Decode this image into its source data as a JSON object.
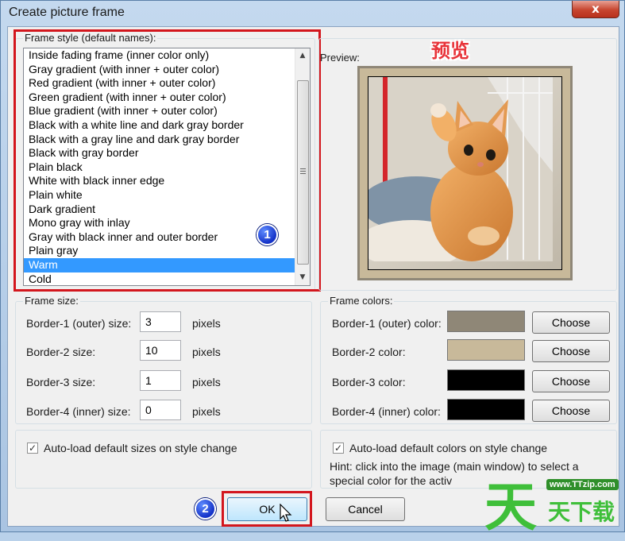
{
  "window": {
    "title": "Create picture frame",
    "close_glyph": "x"
  },
  "frame_style": {
    "group_label": "Frame style (default names):",
    "items": [
      "Inside fading frame (inner color only)",
      "Gray gradient (with inner + outer color)",
      "Red gradient (with inner + outer color)",
      "Green gradient (with inner + outer color)",
      "Blue gradient (with inner + outer color)",
      "Black with a white line and dark gray border",
      "Black with a gray line and dark gray border",
      "Black with gray border",
      "Plain black",
      "White with black inner edge",
      "Plain white",
      "Dark gradient",
      "Mono gray with inlay",
      "Gray with black inner and outer border",
      "Plain gray",
      "Warm",
      "Cold"
    ],
    "selected_index": 15,
    "scroll_up": "▲",
    "scroll_down": "▼"
  },
  "annotation": {
    "preview_cn": "预览",
    "badge_1": "1",
    "badge_2": "2",
    "highlight_color": "#d3161d",
    "badge_color": "#1432c8"
  },
  "preview": {
    "label": "Preview:"
  },
  "frame_size": {
    "group_label": "Frame size:",
    "unit": "pixels",
    "rows": [
      {
        "label": "Border-1 (outer) size:",
        "value": "3"
      },
      {
        "label": "Border-2 size:",
        "value": "10"
      },
      {
        "label": "Border-3 size:",
        "value": "1"
      },
      {
        "label": "Border-4 (inner) size:",
        "value": "0"
      }
    ],
    "autoload_label": "Auto-load default sizes on style change",
    "autoload_checked": true
  },
  "frame_colors": {
    "group_label": "Frame colors:",
    "choose_label": "Choose",
    "rows": [
      {
        "label": "Border-1 (outer) color:",
        "color": "#8f8777"
      },
      {
        "label": "Border-2 color:",
        "color": "#c8b99a"
      },
      {
        "label": "Border-3 color:",
        "color": "#000000"
      },
      {
        "label": "Border-4 (inner) color:",
        "color": "#000000"
      }
    ],
    "autoload_label": "Auto-load default colors on style change",
    "autoload_checked": true,
    "hint_line1": "Hint: click into the image (main window) to select a",
    "hint_line2": "special color for the activ"
  },
  "buttons": {
    "ok": "OK",
    "cancel": "Cancel"
  },
  "watermark": {
    "big_char": "天",
    "url": "www.TTzip.com",
    "text": "天下载"
  }
}
